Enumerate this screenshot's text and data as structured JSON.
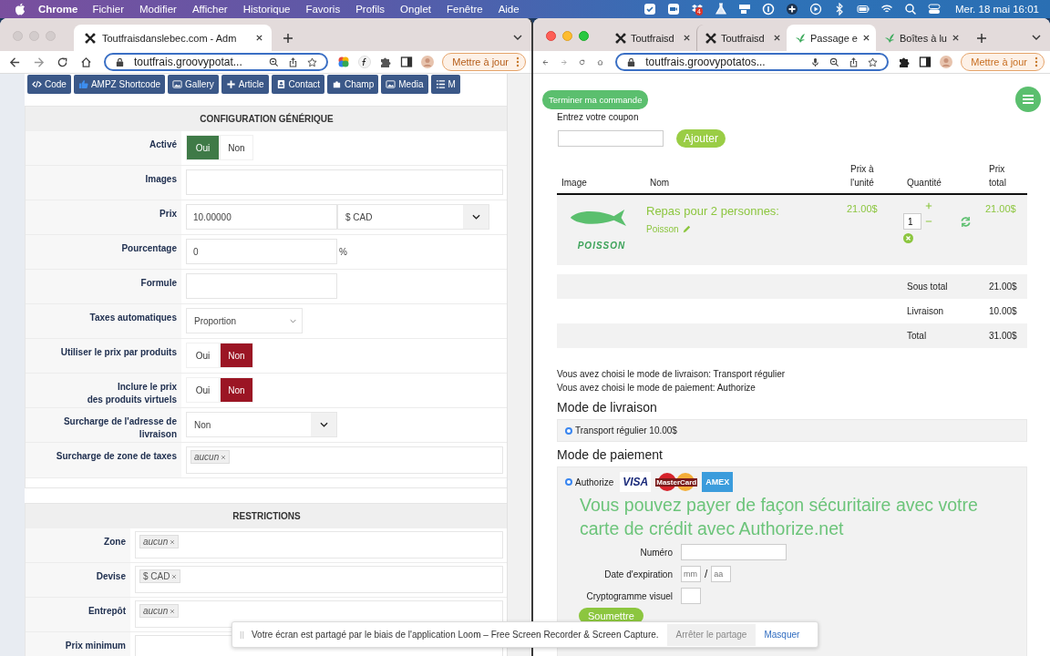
{
  "menu_bar": {
    "app": "Chrome",
    "items": [
      "Fichier",
      "Modifier",
      "Afficher",
      "Historique",
      "Favoris",
      "Profils",
      "Onglet",
      "Fenêtre",
      "Aide"
    ],
    "badge": "4",
    "clock": "Mer. 18 mai 16:01"
  },
  "left_window": {
    "focused": false,
    "tabs": [
      {
        "kind": "admin",
        "title": "Toutfraisdanslebec.com - Adm",
        "selected": true
      }
    ],
    "address": "toutfrais.groovypotat...",
    "update_button": "Mettre à jour",
    "toolbar": [
      "Code",
      "AMPZ Shortcode",
      "Gallery",
      "Article",
      "Contact",
      "Champ",
      "Media",
      "M"
    ],
    "sections": [
      {
        "title": "CONFIGURATION GÉNÉRIQUE",
        "fields": [
          {
            "kind": "toggle",
            "label": "Activé",
            "options": [
              {
                "label": "Oui",
                "selected": true
              },
              {
                "label": "Non",
                "selected": false
              }
            ]
          },
          {
            "kind": "wide",
            "label": "Images"
          },
          {
            "kind": "price",
            "label": "Prix",
            "value": "10.00000",
            "currency": "$ CAD"
          },
          {
            "kind": "percent",
            "label": "Pourcentage",
            "value": "0",
            "suffix": "%"
          },
          {
            "kind": "text",
            "label": "Formule"
          },
          {
            "kind": "select",
            "label": "Taxes automatiques",
            "value": "Proportion"
          },
          {
            "kind": "toggle",
            "label": "Utiliser le prix par produits",
            "options": [
              {
                "label": "Oui",
                "selected": false
              },
              {
                "label": "Non",
                "selected": true
              }
            ]
          },
          {
            "kind": "toggle",
            "label": "Inclure le prix\ndes produits virtuels",
            "options": [
              {
                "label": "Oui",
                "selected": false
              },
              {
                "label": "Non",
                "selected": true
              }
            ]
          },
          {
            "kind": "dropdown",
            "label": "Surcharge de l'adresse de livraison",
            "value": "Non"
          },
          {
            "kind": "tags",
            "label": "Surcharge de zone de taxes",
            "tags": [
              {
                "text": "aucun",
                "italic": true
              }
            ]
          }
        ]
      },
      {
        "title": "RESTRICTIONS",
        "fields": [
          {
            "kind": "tags",
            "label": "Zone",
            "tags": [
              {
                "text": "aucun",
                "italic": true
              }
            ]
          },
          {
            "kind": "tags",
            "label": "Devise",
            "tags": [
              {
                "text": "$ CAD",
                "italic": false
              }
            ]
          },
          {
            "kind": "tags",
            "label": "Entrepôt",
            "tags": [
              {
                "text": "aucun",
                "italic": true
              }
            ]
          },
          {
            "kind": "wide",
            "label": "Prix minimum"
          }
        ]
      }
    ]
  },
  "right_window": {
    "focused": true,
    "tabs": [
      {
        "kind": "admin",
        "title": "Toutfraisd",
        "selected": false
      },
      {
        "kind": "admin",
        "title": "Toutfraisd",
        "selected": false
      },
      {
        "kind": "shop",
        "title": "Passage e",
        "selected": true
      },
      {
        "kind": "shop",
        "title": "Boîtes à lu",
        "selected": false
      }
    ],
    "address": "toutfrais.groovypotatos...",
    "update_button": "Mettre à jour",
    "finish_button": "Terminer ma commande",
    "coupon": {
      "label": "Entrez votre coupon",
      "button": "Ajouter"
    },
    "cart": {
      "columns": [
        "Image",
        "Nom",
        "Prix à\nl'unité",
        "Quantité",
        "Prix\ntotal"
      ],
      "items": [
        {
          "image_text": "POISSON",
          "name": "Repas pour 2 personnes:",
          "option": "Poisson",
          "unit_price": "21.00$",
          "quantity": "1",
          "total": "21.00$"
        }
      ],
      "summary": [
        {
          "label": "Sous total",
          "value": "21.00$"
        },
        {
          "label": "Livraison",
          "value": "10.00$"
        },
        {
          "label": "Total",
          "value": "31.00$"
        }
      ]
    },
    "notes": [
      "Vous avez choisi le mode de livraison: Transport régulier",
      "Vous avez choisi le mode de paiement: Authorize"
    ],
    "shipping": {
      "title": "Mode de livraison",
      "options": [
        {
          "label": "Transport régulier 10.00$",
          "selected": true
        }
      ]
    },
    "payment": {
      "title": "Mode de paiement",
      "options": [
        {
          "label": "Authorize",
          "selected": true
        }
      ],
      "cards": [
        "VISA",
        "MasterCard",
        "AMEX"
      ],
      "message": "Vous pouvez payer de façon sécuritaire avec votre carte de crédit avec Authorize.net",
      "fields": [
        {
          "kind": "text",
          "label": "Numéro"
        },
        {
          "kind": "expiry",
          "label": "Date d'expiration",
          "placeholders": [
            "mm",
            "aa"
          ],
          "separator": "/"
        },
        {
          "kind": "short",
          "label": "Cryptogramme visuel"
        }
      ],
      "submit": "Soumettre"
    }
  },
  "notification": {
    "message": "Votre écran est partagé par le biais de l'application Loom – Free Screen Recorder & Screen Capture.",
    "stop_button": "Arrêter le partage",
    "hide_link": "Masquer"
  }
}
